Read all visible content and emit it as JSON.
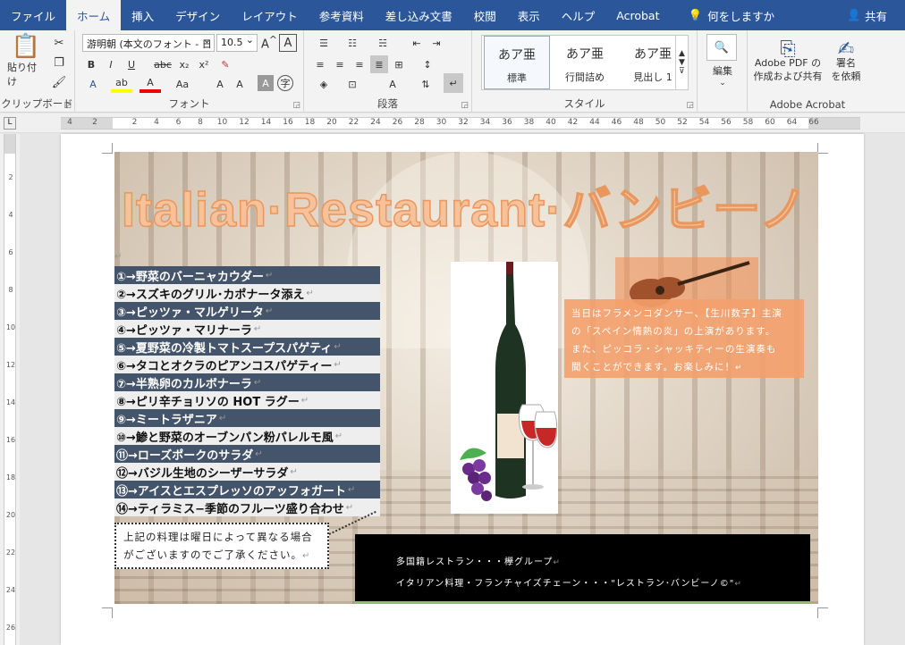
{
  "tabs": [
    "ファイル",
    "ホーム",
    "挿入",
    "デザイン",
    "レイアウト",
    "参考資料",
    "差し込み文書",
    "校閲",
    "表示",
    "ヘルプ",
    "Acrobat"
  ],
  "tell_me": "何をしますか",
  "share": "共有",
  "ribbon": {
    "clipboard": {
      "paste": "貼り付け",
      "label": "クリップボード"
    },
    "font": {
      "family": "游明朝 (本文のフォント - 日",
      "size": "10.5",
      "label": "フォント"
    },
    "paragraph": {
      "label": "段落"
    },
    "styles": {
      "label": "スタイル",
      "items": [
        {
          "preview": "あア亜",
          "name": "標準"
        },
        {
          "preview": "あア亜",
          "name": "行間詰め"
        },
        {
          "preview": "あア亜",
          "name": "見出し 1"
        }
      ]
    },
    "editing": {
      "label": "編集"
    },
    "acrobat": {
      "create": "Adobe PDF の",
      "create2": "作成および共有",
      "sign": "署名",
      "sign2": "を依頼",
      "label": "Adobe Acrobat"
    }
  },
  "ruler": {
    "h_ticks": [
      "4",
      "2",
      "2",
      "4",
      "6",
      "8",
      "10",
      "12",
      "14",
      "16",
      "18",
      "20",
      "22",
      "24",
      "26",
      "28",
      "30",
      "32",
      "34",
      "36",
      "38",
      "40",
      "42",
      "44",
      "46",
      "48",
      "50",
      "52",
      "54",
      "56",
      "58",
      "60",
      "64",
      "66"
    ],
    "v_ticks": [
      "2",
      "4",
      "6",
      "8",
      "10",
      "12",
      "14",
      "16",
      "18",
      "20",
      "22",
      "24",
      "26"
    ]
  },
  "document": {
    "title": "Italian·Restaurant·バンビーノ",
    "menu": [
      "①→野菜のバーニャカウダー",
      "②→スズキのグリル･カポナータ添え",
      "③→ピッツァ・マルゲリータ",
      "④→ピッツァ・マリナーラ",
      "⑤→夏野菜の冷製トマトスープスパゲティ",
      "⑥→タコとオクラのピアンコスパゲティー",
      "⑦→半熟卵のカルボナーラ",
      "⑧→ピリ辛チョリソの HOT ラグー",
      "⑨→ミートラザニア",
      "⑩→鯵と野菜のオーブンパン粉パレルモ風",
      "⑪→ローズポークのサラダ",
      "⑫→バジル生地のシーザーサラダ",
      "⑬→アイスとエスプレッソのアッフォガート",
      "⑭→ティラミス−季節のフルーツ盛り合わせ"
    ],
    "note_line1": "上記の料理は曜日によって異なる場合",
    "note_line2": "がございますのでご了承ください。",
    "live_line1": "当日はフラメンコダンサー、【生川数子】主演",
    "live_line2": "の「スペイン情熱の炎」の上演があります。",
    "live_line3": "また、ピッコラ・シャッキティーの生演奏も",
    "live_line4": "聞くことができます。お楽しみに！",
    "footer_line1": "多国籍レストラン・・・欅グループ",
    "footer_line2": "イタリアン料理・フランチャイズチェーン・・・\"レストラン･バンビーノ©\""
  }
}
